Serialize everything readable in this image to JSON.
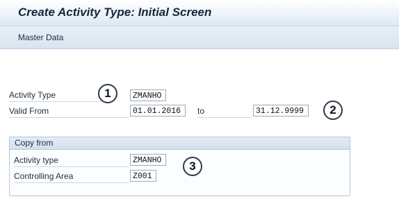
{
  "window": {
    "title": "Create Activity Type: Initial Screen"
  },
  "menu": {
    "master_data": "Master Data"
  },
  "form": {
    "activity_type_label": "Activity Type",
    "activity_type_value": "ZMANHO",
    "valid_from_label": "Valid From",
    "valid_from_value": "01.01.2016",
    "to_label": "to",
    "valid_to_value": "31.12.9999"
  },
  "copy_from": {
    "header": "Copy from",
    "activity_type_label": "Activity type",
    "activity_type_value": "ZMANHO",
    "controlling_area_label": "Controlling Area",
    "controlling_area_value": "Z001"
  },
  "callouts": [
    "1",
    "2",
    "3"
  ]
}
